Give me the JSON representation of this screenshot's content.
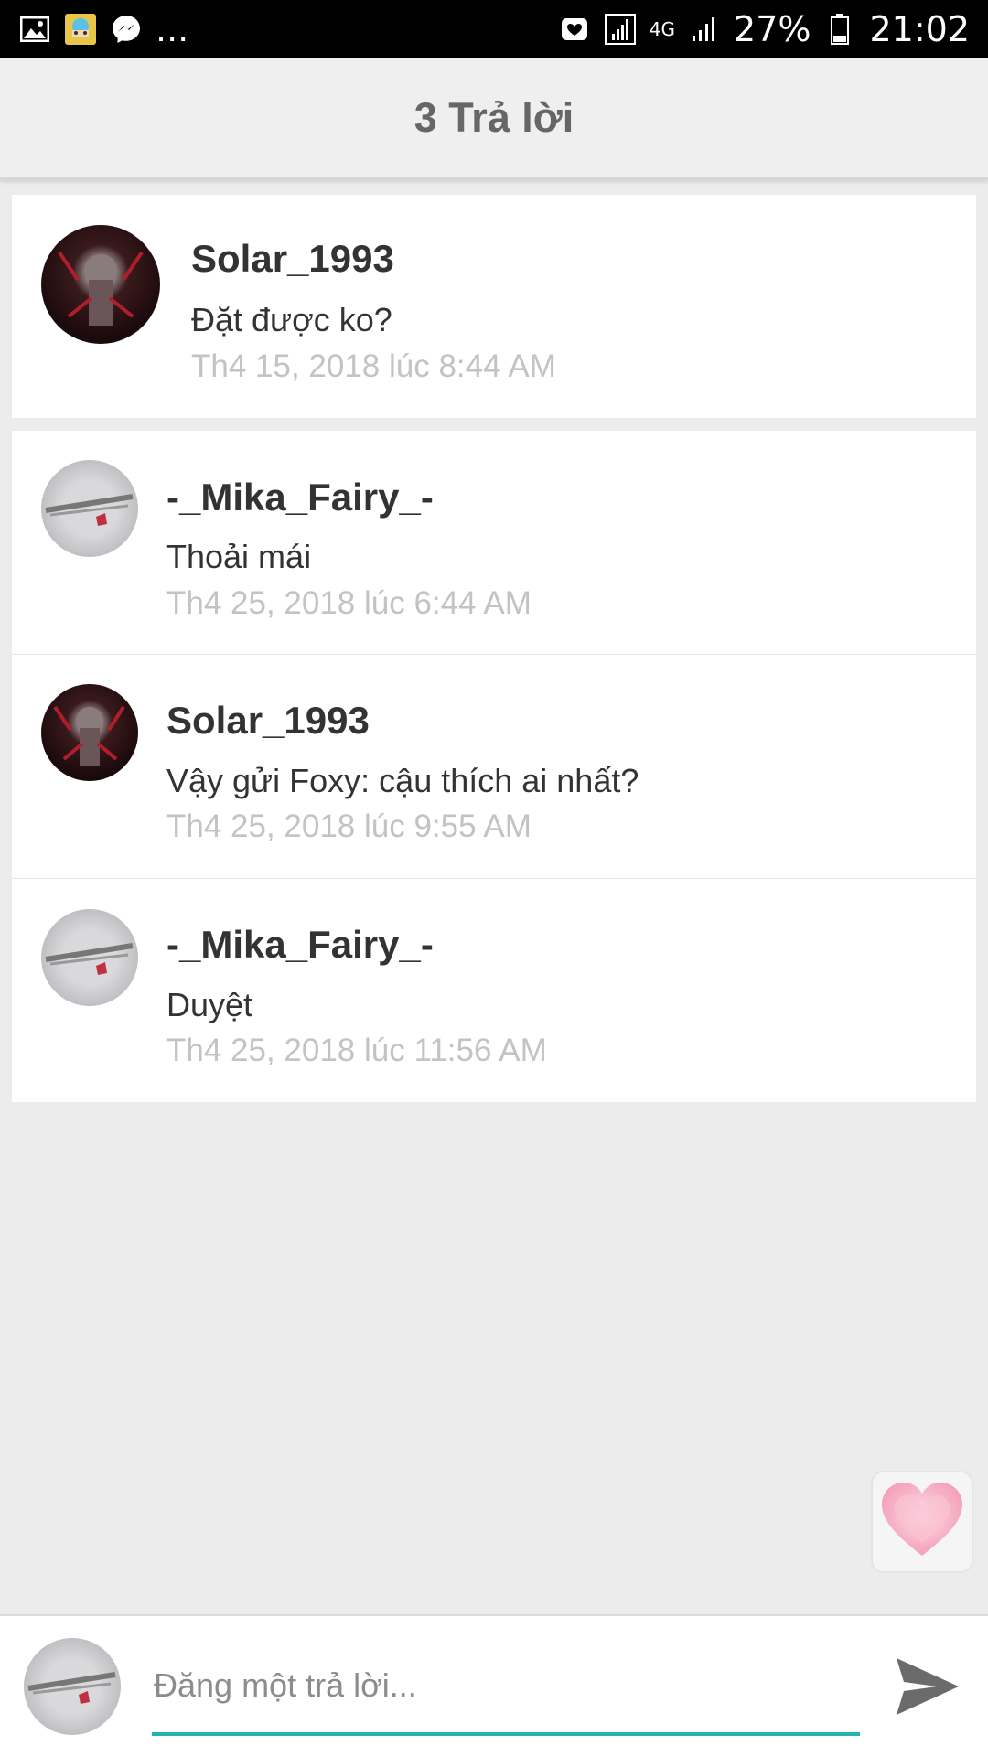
{
  "status_bar": {
    "battery": "27%",
    "time": "21:02",
    "network": "4G",
    "more": "...",
    "icons_left": [
      "gallery-icon",
      "app-avatar-icon",
      "messenger-icon"
    ],
    "icons_right": [
      "notification-icon",
      "signal-icon",
      "4g-icon",
      "signal-bars-icon",
      "battery-icon"
    ]
  },
  "header": {
    "title": "3 Trả lời"
  },
  "post": {
    "username": "Solar_1993",
    "message": "Đặt được ko?",
    "timestamp": "Th4 15, 2018 lúc 8:44 AM"
  },
  "replies": [
    {
      "username": "-_Mika_Fairy_-",
      "message": "Thoải mái",
      "timestamp": "Th4 25, 2018 lúc 6:44 AM"
    },
    {
      "username": "Solar_1993",
      "message": "Vậy gửi Foxy: cậu thích ai nhất?",
      "timestamp": "Th4 25, 2018 lúc 9:55 AM"
    },
    {
      "username": "-_Mika_Fairy_-",
      "message": "Duyệt",
      "timestamp": "Th4 25, 2018 lúc 11:56 AM"
    }
  ],
  "composer": {
    "placeholder": "Đăng một trả lời...",
    "value": ""
  },
  "colors": {
    "accent": "#1fb5ad",
    "background": "#ececec",
    "timestamp": "#c3c3c3",
    "like": "#f7a9c0"
  },
  "icons": {
    "like": "heart-icon",
    "send": "send-icon"
  }
}
